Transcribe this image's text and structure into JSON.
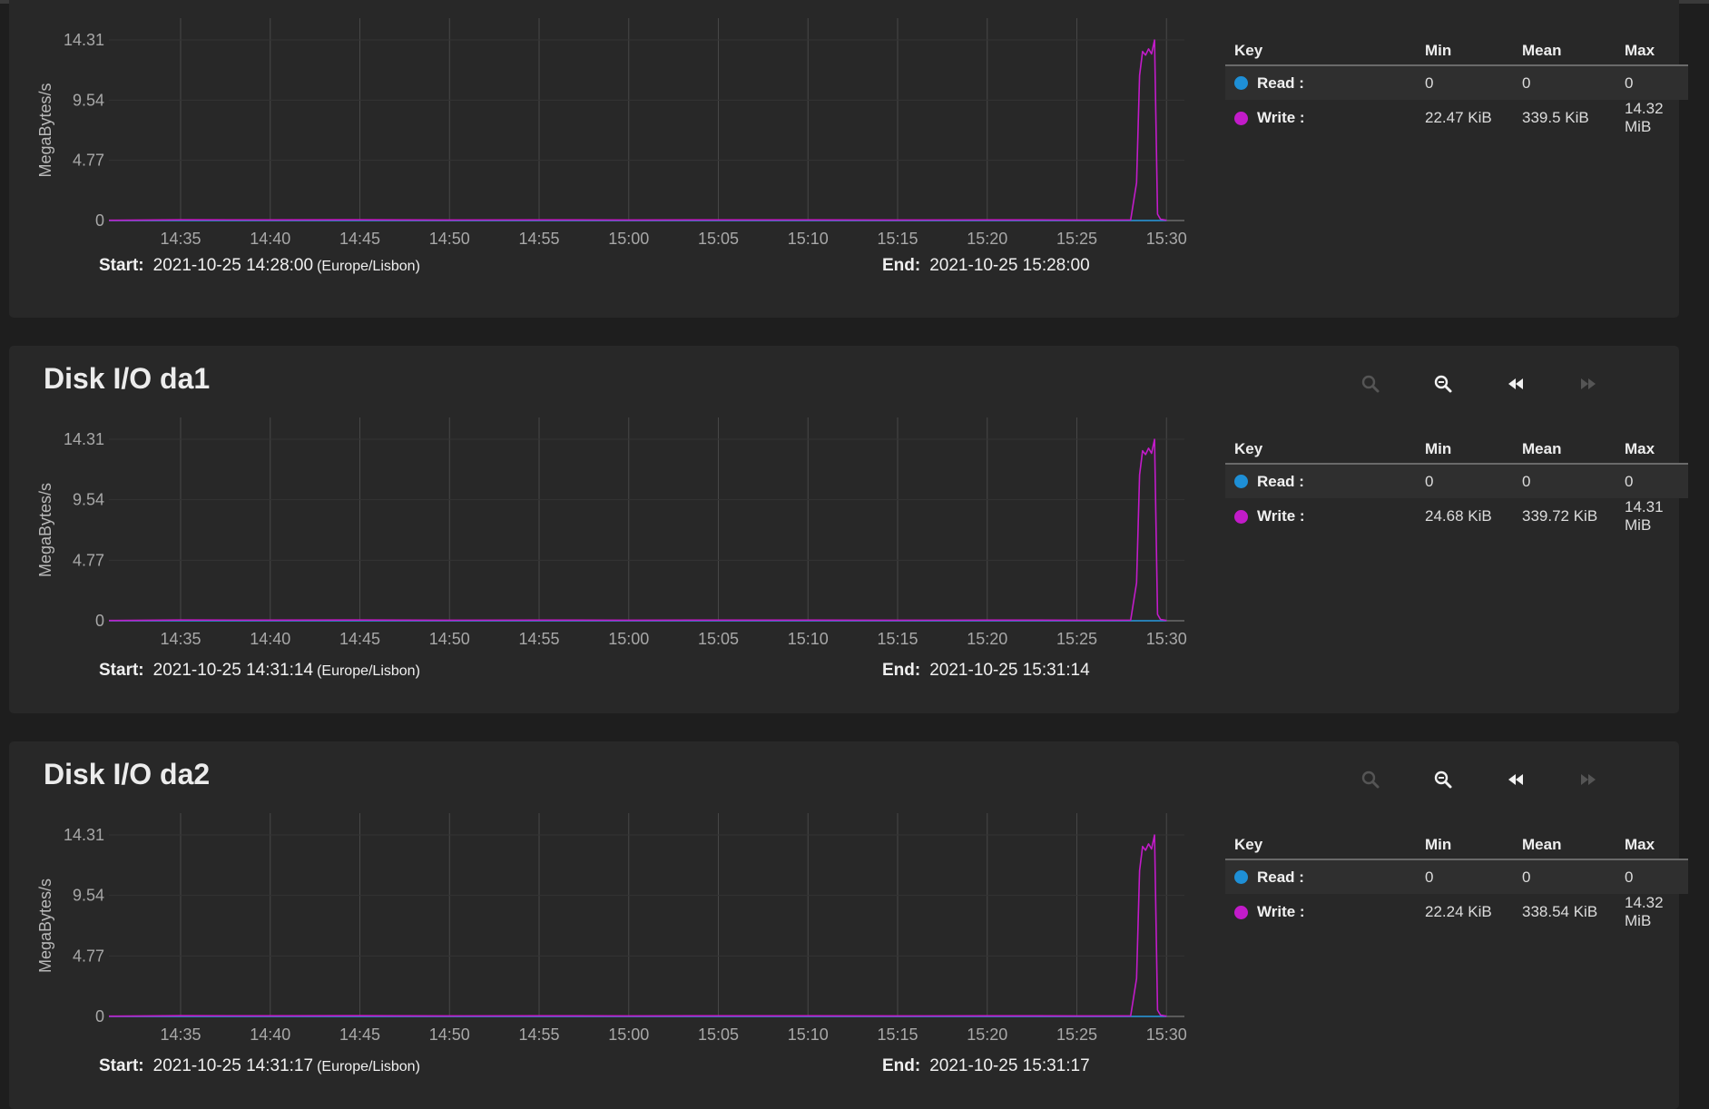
{
  "panels": [
    {
      "title": "",
      "ylabel": "MegaBytes/s",
      "start_label": "Start:",
      "start_value": "2021-10-25 14:28:00",
      "timezone": "(Europe/Lisbon)",
      "end_label": "End:",
      "end_value": "2021-10-25 15:28:00",
      "legend": {
        "headers": [
          "Key",
          "Min",
          "Mean",
          "Max"
        ],
        "rows": [
          {
            "name": "Read :",
            "color": "#1e8fd6",
            "min": "0",
            "mean": "0",
            "max": "0"
          },
          {
            "name": "Write :",
            "color": "#c21bc9",
            "min": "22.47 KiB",
            "mean": "339.5 KiB",
            "max": "14.32 MiB"
          }
        ]
      }
    },
    {
      "title": "Disk I/O da1",
      "ylabel": "MegaBytes/s",
      "start_label": "Start:",
      "start_value": "2021-10-25 14:31:14",
      "timezone": "(Europe/Lisbon)",
      "end_label": "End:",
      "end_value": "2021-10-25 15:31:14",
      "legend": {
        "headers": [
          "Key",
          "Min",
          "Mean",
          "Max"
        ],
        "rows": [
          {
            "name": "Read :",
            "color": "#1e8fd6",
            "min": "0",
            "mean": "0",
            "max": "0"
          },
          {
            "name": "Write :",
            "color": "#c21bc9",
            "min": "24.68 KiB",
            "mean": "339.72 KiB",
            "max": "14.31 MiB"
          }
        ]
      }
    },
    {
      "title": "Disk I/O da2",
      "ylabel": "MegaBytes/s",
      "start_label": "Start:",
      "start_value": "2021-10-25 14:31:17",
      "timezone": "(Europe/Lisbon)",
      "end_label": "End:",
      "end_value": "2021-10-25 15:31:17",
      "legend": {
        "headers": [
          "Key",
          "Min",
          "Mean",
          "Max"
        ],
        "rows": [
          {
            "name": "Read :",
            "color": "#1e8fd6",
            "min": "0",
            "mean": "0",
            "max": "0"
          },
          {
            "name": "Write :",
            "color": "#c21bc9",
            "min": "22.24 KiB",
            "mean": "338.54 KiB",
            "max": "14.32 MiB"
          }
        ]
      }
    }
  ],
  "toolbar_icons": [
    "zoom-in-icon",
    "zoom-out-icon",
    "step-back-icon",
    "step-forward-icon"
  ],
  "colors": {
    "read": "#1e8fd6",
    "write": "#c21bc9",
    "grid": "#4a4a4a",
    "panel": "#282828",
    "background": "#1e1e1e"
  },
  "chart_data": [
    {
      "type": "line",
      "ylabel": "MegaBytes/s",
      "xlabel": "",
      "y_ticks": [
        "0",
        "4.77",
        "9.54",
        "14.31"
      ],
      "x_ticks": [
        "14:35",
        "14:40",
        "14:45",
        "14:50",
        "14:55",
        "15:00",
        "15:05",
        "15:10",
        "15:15",
        "15:20",
        "15:25",
        "15:30"
      ],
      "ylim": [
        0,
        14.31
      ],
      "grid": "vertical",
      "series": [
        {
          "name": "Read",
          "color": "#1e8fd6",
          "x": [
            "14:31",
            "15:30"
          ],
          "y": [
            0,
            0
          ]
        },
        {
          "name": "Write",
          "color": "#c21bc9",
          "x": [
            "14:31",
            "14:35",
            "14:40",
            "14:45",
            "14:50",
            "14:55",
            "15:00",
            "15:05",
            "15:10",
            "15:15",
            "15:20",
            "15:25",
            "15:28",
            "15:28:20",
            "15:28:30",
            "15:28:40",
            "15:28:50",
            "15:29",
            "15:29:10",
            "15:29:20",
            "15:29:30",
            "15:29:40",
            "15:30"
          ],
          "y": [
            0.02,
            0.06,
            0.05,
            0.06,
            0.04,
            0.05,
            0.04,
            0.05,
            0.05,
            0.04,
            0.05,
            0.04,
            0.05,
            3.0,
            11.5,
            13.4,
            13.1,
            13.6,
            13.2,
            14.3,
            0.5,
            0.1,
            0.02
          ]
        }
      ]
    },
    {
      "type": "line",
      "ylabel": "MegaBytes/s",
      "xlabel": "",
      "y_ticks": [
        "0",
        "4.77",
        "9.54",
        "14.31"
      ],
      "x_ticks": [
        "14:35",
        "14:40",
        "14:45",
        "14:50",
        "14:55",
        "15:00",
        "15:05",
        "15:10",
        "15:15",
        "15:20",
        "15:25",
        "15:30"
      ],
      "ylim": [
        0,
        14.31
      ],
      "grid": "vertical",
      "series": [
        {
          "name": "Read",
          "color": "#1e8fd6",
          "x": [
            "14:31",
            "15:30"
          ],
          "y": [
            0,
            0
          ]
        },
        {
          "name": "Write",
          "color": "#c21bc9",
          "x": [
            "14:31",
            "14:35",
            "14:40",
            "14:45",
            "14:50",
            "14:55",
            "15:00",
            "15:05",
            "15:10",
            "15:15",
            "15:20",
            "15:25",
            "15:28",
            "15:28:20",
            "15:28:30",
            "15:28:40",
            "15:28:50",
            "15:29",
            "15:29:10",
            "15:29:20",
            "15:29:30",
            "15:29:40",
            "15:30"
          ],
          "y": [
            0.02,
            0.06,
            0.05,
            0.06,
            0.04,
            0.05,
            0.04,
            0.05,
            0.05,
            0.04,
            0.05,
            0.04,
            0.05,
            3.0,
            11.5,
            13.4,
            13.1,
            13.6,
            13.2,
            14.3,
            0.5,
            0.1,
            0.02
          ]
        }
      ]
    },
    {
      "type": "line",
      "ylabel": "MegaBytes/s",
      "xlabel": "",
      "y_ticks": [
        "0",
        "4.77",
        "9.54",
        "14.31"
      ],
      "x_ticks": [
        "14:35",
        "14:40",
        "14:45",
        "14:50",
        "14:55",
        "15:00",
        "15:05",
        "15:10",
        "15:15",
        "15:20",
        "15:25",
        "15:30"
      ],
      "ylim": [
        0,
        14.31
      ],
      "grid": "vertical",
      "series": [
        {
          "name": "Read",
          "color": "#1e8fd6",
          "x": [
            "14:31",
            "15:30"
          ],
          "y": [
            0,
            0
          ]
        },
        {
          "name": "Write",
          "color": "#c21bc9",
          "x": [
            "14:31",
            "14:35",
            "14:40",
            "14:45",
            "14:50",
            "14:55",
            "15:00",
            "15:05",
            "15:10",
            "15:15",
            "15:20",
            "15:25",
            "15:28",
            "15:28:20",
            "15:28:30",
            "15:28:40",
            "15:28:50",
            "15:29",
            "15:29:10",
            "15:29:20",
            "15:29:30",
            "15:29:40",
            "15:30"
          ],
          "y": [
            0.02,
            0.06,
            0.05,
            0.06,
            0.04,
            0.05,
            0.04,
            0.05,
            0.05,
            0.04,
            0.05,
            0.04,
            0.05,
            3.0,
            11.5,
            13.4,
            13.1,
            13.6,
            13.2,
            14.3,
            0.5,
            0.1,
            0.02
          ]
        }
      ]
    }
  ]
}
